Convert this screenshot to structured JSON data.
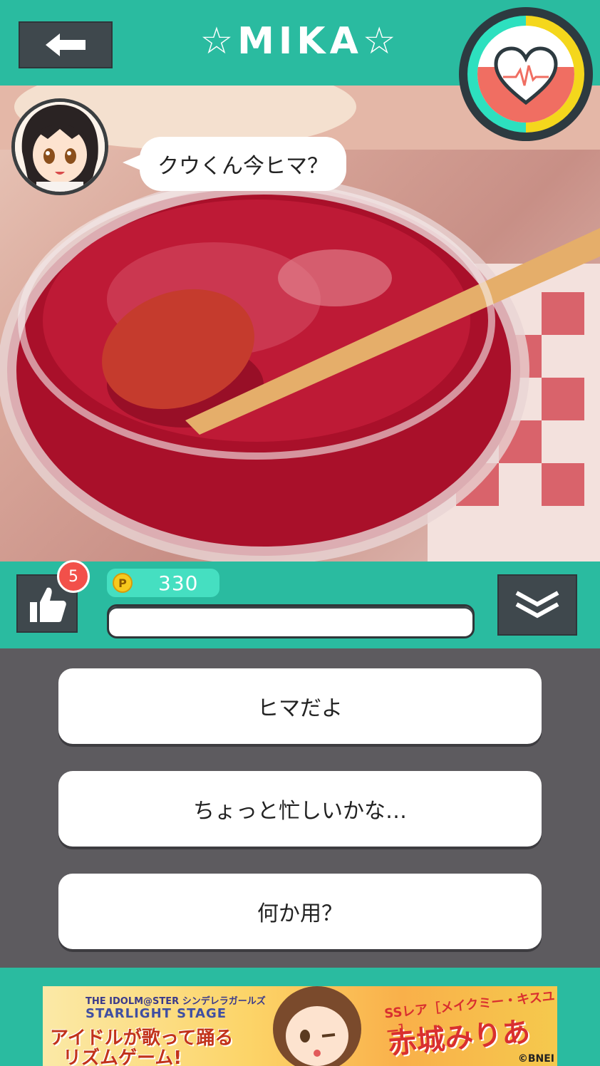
{
  "header": {
    "title": "☆MIKA☆",
    "back_icon": "arrow-left-icon",
    "gauge_icon": "heart-pulse-icon",
    "gauge_level": 0.5
  },
  "chat": {
    "avatar_icon": "character-avatar",
    "message": "クウくん今ヒマ？"
  },
  "controls": {
    "like_icon": "thumbs-up-icon",
    "like_badge": "5",
    "coin_icon": "P",
    "points": "330",
    "expand_icon": "double-chevron-down-icon"
  },
  "choices": [
    "ヒマだよ",
    "ちょっと忙しいかな…",
    "何か用？"
  ],
  "ad": {
    "brand": "THE IDOLM@STER シンデレラガールズ",
    "subtitle": "STARLIGHT STAGE",
    "line1": "アイドルが歌って踊る",
    "line2": "リズムゲーム!",
    "rarity": "SSレア［メイクミー・キスユー］",
    "name": "赤城みりあ",
    "copyright": "©BNEI"
  },
  "colors": {
    "teal": "#2abba0",
    "dark_button": "#3f484d",
    "choice_bg": "#5d5b5f",
    "badge": "#f2504a",
    "gauge_heart": "#f06e62"
  }
}
